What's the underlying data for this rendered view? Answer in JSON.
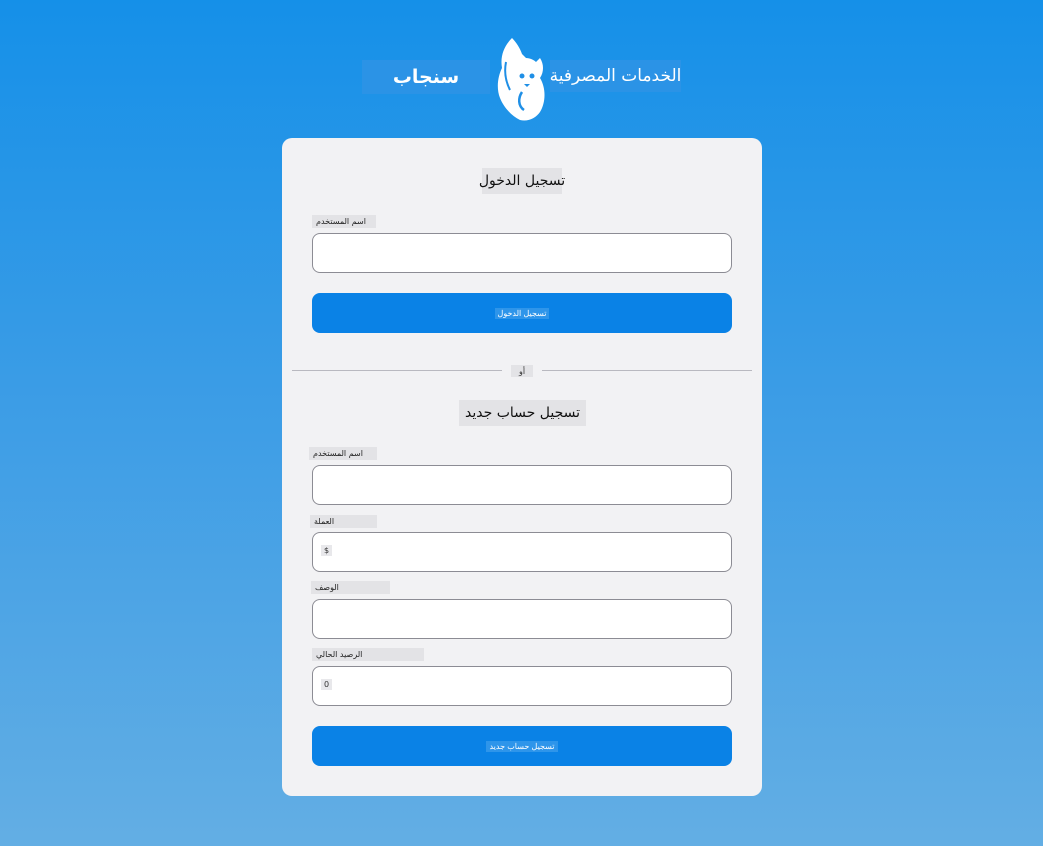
{
  "brand": {
    "name": "سنجاب",
    "tagline": "الخدمات المصرفية"
  },
  "login": {
    "title": "تسجيل الدخول",
    "username_label": "اسم المستخدم",
    "username_value": "",
    "submit_label": "تسجيل الدخول"
  },
  "divider": {
    "text": "أو"
  },
  "register": {
    "title": "تسجيل حساب جديد",
    "username_label": "اسم المستخدم",
    "username_value": "",
    "currency_label": "العملة",
    "currency_value": "$",
    "description_label": "الوصف",
    "description_value": "",
    "balance_label": "الرصيد الحالي",
    "balance_value": "0",
    "submit_label": "تسجيل حساب جديد"
  },
  "colors": {
    "primary": "#0a82e6",
    "card": "#f2f2f4",
    "background_top": "#1590e8",
    "background_bottom": "#63aee4"
  },
  "icons": {
    "logo": "squirrel-icon"
  }
}
